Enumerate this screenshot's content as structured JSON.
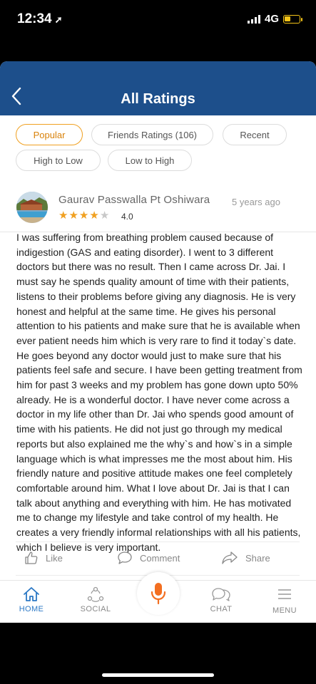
{
  "status_bar": {
    "time": "12:34",
    "network": "4G"
  },
  "header": {
    "title": "All Ratings"
  },
  "filters": {
    "chips": [
      {
        "label": "Popular",
        "active": true
      },
      {
        "label": "Friends Ratings (106)",
        "active": false
      },
      {
        "label": "Recent",
        "active": false
      },
      {
        "label": "High to Low",
        "active": false
      },
      {
        "label": "Low to High",
        "active": false
      }
    ]
  },
  "review": {
    "reviewer_name": "Gaurav Passwalla Pt Oshiwara",
    "age": "5 years ago",
    "rating": "4.0",
    "stars_filled": 4,
    "stars_total": 5,
    "text": "I was suffering from breathing problem caused because of indigestion (GAS and eating disorder). I went to 3 different doctors but there was no result. Then I came across Dr. Jai. I must say he spends quality amount of time with their patients, listens to their problems before giving any diagnosis. He is very honest and helpful at the same time. He gives his personal attention to his patients and make sure that he is available when ever patient needs him which is very rare to find it today`s date. He goes beyond any doctor would just to make sure that his patients feel safe and secure. I have been getting treatment from him for past 3 weeks and my problem has gone down upto 50% already. He is a wonderful doctor. I have never come across a doctor in my life other than Dr. Jai who spends good amount of time with his patients. He did not just go through my medical reports but also explained me the why`s and how`s in a simple language which is what impresses me the most about him. His friendly nature and positive attitude makes one feel completely comfortable around him. What I love about Dr. Jai is that I can talk about anything and everything with him. He has motivated me to change my lifestyle and take control of my health. He creates a very friendly informal relationships with all his patients, which I believe is very important."
  },
  "actions": {
    "like": "Like",
    "comment": "Comment",
    "share": "Share"
  },
  "tabbar": {
    "home": "HOME",
    "social": "SOCIAL",
    "chat": "CHAT",
    "menu": "MENU"
  },
  "colors": {
    "header_bg": "#1d4f8b",
    "accent_orange": "#f0a020",
    "active_tab": "#2b78c5"
  }
}
